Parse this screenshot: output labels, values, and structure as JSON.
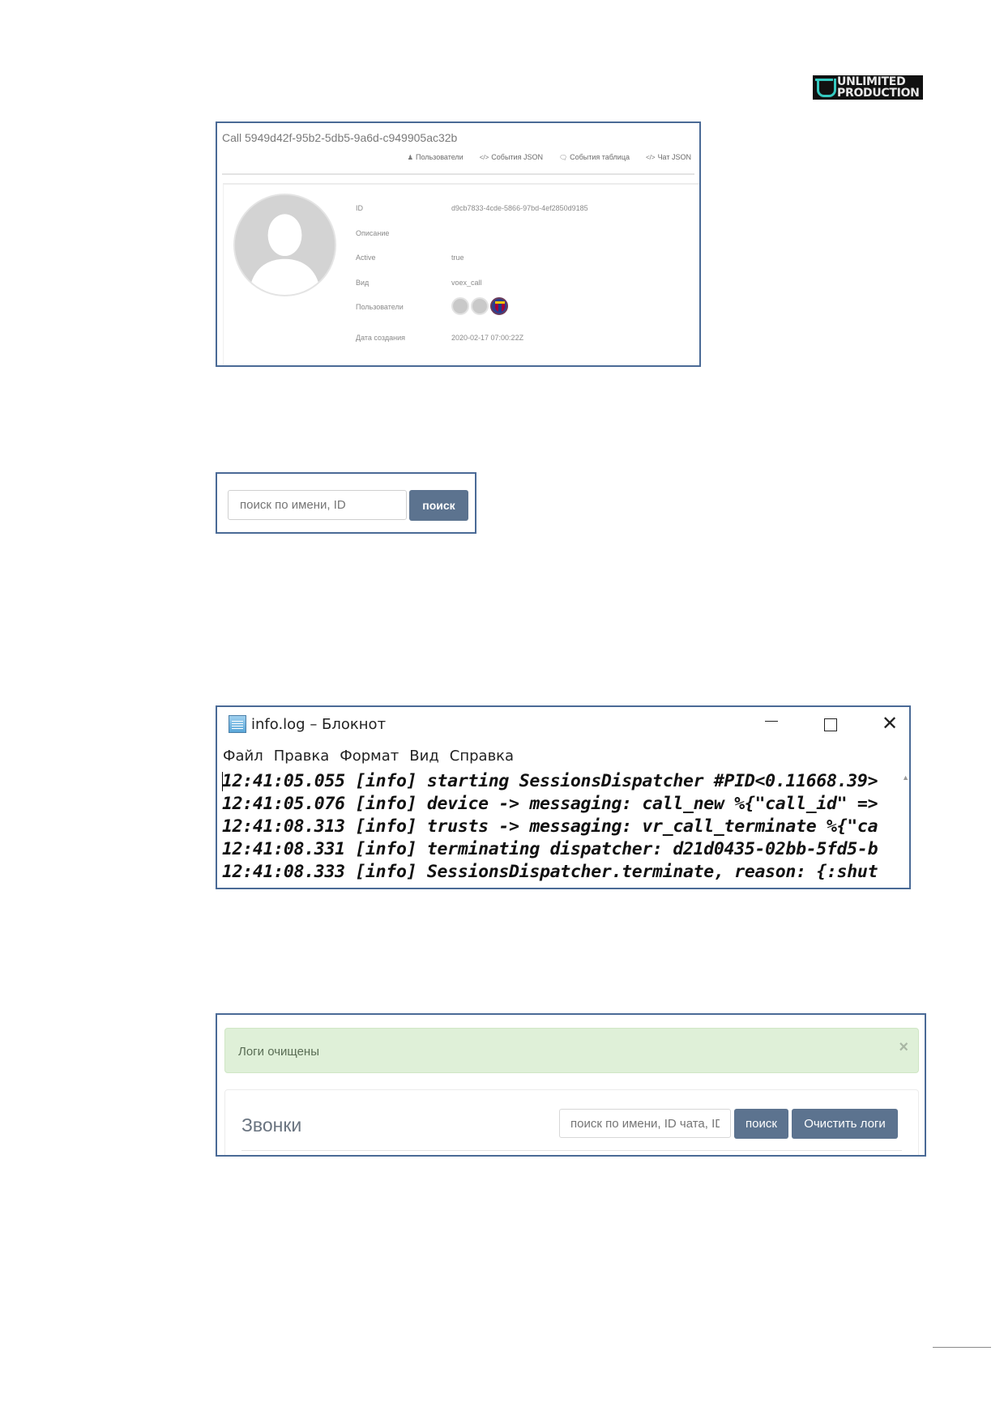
{
  "logo": {
    "line1": "UNLIMITED",
    "line2": "PRODUCTION"
  },
  "call_card": {
    "title": "Call 5949d42f-95b2-5db5-9a6d-c949905ac32b",
    "tabs": [
      {
        "icon": "user-icon",
        "label": "Пользователи"
      },
      {
        "icon": "code-icon",
        "label": "События JSON"
      },
      {
        "icon": "comments-icon",
        "label": "События таблица"
      },
      {
        "icon": "code-icon",
        "label": "Чат JSON"
      }
    ],
    "fields": [
      {
        "key": "ID",
        "value": "d9cb7833-4cde-5866-97bd-4ef2850d9185"
      },
      {
        "key": "Описание",
        "value": ""
      },
      {
        "key": "Active",
        "value": "true"
      },
      {
        "key": "Вид",
        "value": "voex_call"
      },
      {
        "key": "Пользователи",
        "value": ""
      },
      {
        "key": "Дата создания",
        "value": "2020-02-17 07:00:22Z"
      }
    ],
    "users_avatar_count": 3
  },
  "search_box": {
    "placeholder": "поиск по имени, ID",
    "button": "поиск"
  },
  "notepad": {
    "title": "info.log – Блокнот",
    "menu": [
      "Файл",
      "Правка",
      "Формат",
      "Вид",
      "Справка"
    ],
    "lines": [
      "12:41:05.055  [info] starting SessionsDispatcher #PID<0.11668.39>",
      "12:41:05.076  [info] device -> messaging: call_new %{\"call_id\" =>",
      "12:41:08.313  [info] trusts -> messaging: vr_call_terminate %{\"ca",
      "12:41:08.331  [info] terminating dispatcher: d21d0435-02bb-5fd5-b",
      "12:41:08.333  [info] SessionsDispatcher.terminate, reason: {:shut"
    ]
  },
  "logs_cleared": {
    "alert": "Логи очищены",
    "alert_close": "×",
    "section_title": "Звонки",
    "search_placeholder": "поиск по имени, ID чата, ID",
    "search_button": "поиск",
    "clear_button": "Очистить логи"
  }
}
